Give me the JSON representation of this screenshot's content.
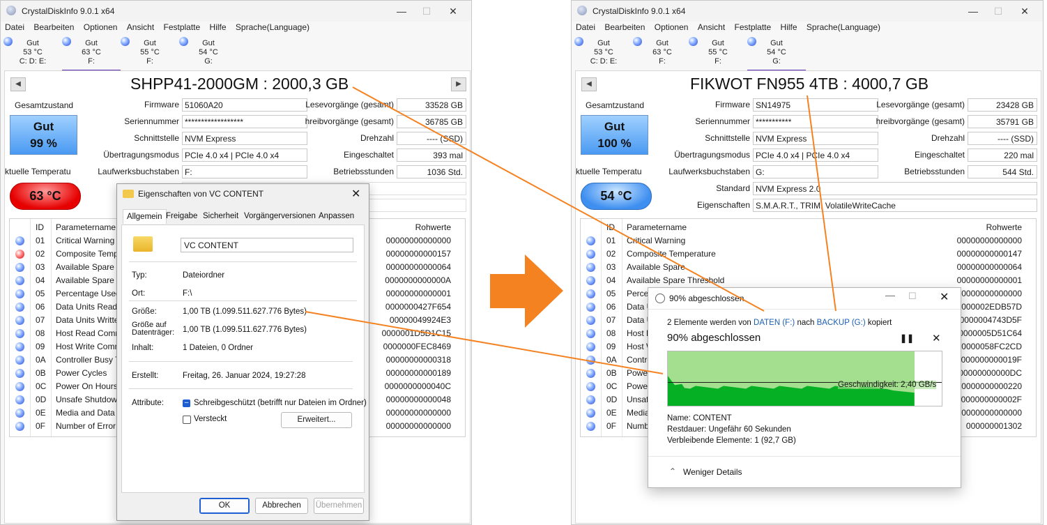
{
  "left_window": {
    "title": "CrystalDiskInfo 9.0.1 x64",
    "menu": [
      "Datei",
      "Bearbeiten",
      "Optionen",
      "Ansicht",
      "Festplatte",
      "Hilfe",
      "Sprache(Language)"
    ],
    "drives": [
      {
        "status": "Gut",
        "temp": "53 °C",
        "letters": "C: D: E:"
      },
      {
        "status": "Gut",
        "temp": "63 °C",
        "letters": "F:"
      },
      {
        "status": "Gut",
        "temp": "55 °C",
        "letters": "F:"
      },
      {
        "status": "Gut",
        "temp": "54 °C",
        "letters": "G:"
      }
    ],
    "model": "SHPP41-2000GM : 2000,3 GB",
    "health_label": "Gesamtzustand",
    "health_status": "Gut",
    "health_percent": "99 %",
    "temp_label": "ktuelle Temperatu",
    "temp_value": "63 °C",
    "labels": {
      "firmware": "Firmware",
      "serial": "Seriennummer",
      "interface": "Schnittstelle",
      "transfer": "Übertragungsmodus",
      "letters": "Laufwerksbuchstaben",
      "reads": "Lesevorgänge (gesamt)",
      "writes": "hreibvorgänge (gesamt)",
      "rpm": "Drehzahl",
      "poweron": "Eingeschaltet",
      "hours": "Betriebsstunden"
    },
    "values": {
      "firmware": "51060A20",
      "serial": "******************",
      "interface": "NVM Express",
      "transfer": "PCIe 4.0 x4 | PCIe 4.0 x4",
      "letters": "F:",
      "reads": "33528 GB",
      "writes": "36785 GB",
      "rpm": "---- (SSD)",
      "poweron": "393 mal",
      "hours": "1036 Std."
    },
    "smart_headers": {
      "id": "ID",
      "name": "Parametername",
      "raw": "Rohwerte"
    },
    "smart_rows": [
      {
        "id": "01",
        "name": "Critical Warning",
        "raw": "00000000000000",
        "state": "ok"
      },
      {
        "id": "02",
        "name": "Composite Tempe",
        "raw": "00000000000157",
        "state": "warn"
      },
      {
        "id": "03",
        "name": "Available Spare",
        "raw": "00000000000064",
        "state": "ok"
      },
      {
        "id": "04",
        "name": "Available Spare T",
        "raw": "0000000000000A",
        "state": "ok"
      },
      {
        "id": "05",
        "name": "Percentage Used",
        "raw": "00000000000001",
        "state": "ok"
      },
      {
        "id": "06",
        "name": "Data Units Read",
        "raw": "0000000427F654",
        "state": "ok"
      },
      {
        "id": "07",
        "name": "Data Units Writte",
        "raw": "00000049924E3",
        "state": "ok"
      },
      {
        "id": "08",
        "name": "Host Read Comm",
        "raw": "0000001D5D1C15",
        "state": "ok"
      },
      {
        "id": "09",
        "name": "Host Write Comm",
        "raw": "0000000FEC8469",
        "state": "ok"
      },
      {
        "id": "0A",
        "name": "Controller Busy T",
        "raw": "00000000000318",
        "state": "ok"
      },
      {
        "id": "0B",
        "name": "Power Cycles",
        "raw": "00000000000189",
        "state": "ok"
      },
      {
        "id": "0C",
        "name": "Power On Hours",
        "raw": "0000000000040C",
        "state": "ok"
      },
      {
        "id": "0D",
        "name": "Unsafe Shutdowr",
        "raw": "00000000000048",
        "state": "ok"
      },
      {
        "id": "0E",
        "name": "Media and Data I",
        "raw": "00000000000000",
        "state": "ok"
      },
      {
        "id": "0F",
        "name": "Number of Error I",
        "raw": "00000000000000",
        "state": "ok"
      }
    ]
  },
  "right_window": {
    "title": "CrystalDiskInfo 9.0.1 x64",
    "menu": [
      "Datei",
      "Bearbeiten",
      "Optionen",
      "Ansicht",
      "Festplatte",
      "Hilfe",
      "Sprache(Language)"
    ],
    "drives": [
      {
        "status": "Gut",
        "temp": "53 °C",
        "letters": "C: D: E:"
      },
      {
        "status": "Gut",
        "temp": "63 °C",
        "letters": "F:"
      },
      {
        "status": "Gut",
        "temp": "55 °C",
        "letters": "F:"
      },
      {
        "status": "Gut",
        "temp": "54 °C",
        "letters": "G:"
      }
    ],
    "model": "FIKWOT FN955 4TB : 4000,7 GB",
    "health_label": "Gesamtzustand",
    "health_status": "Gut",
    "health_percent": "100 %",
    "temp_label": "ktuelle Temperatu",
    "temp_value": "54 °C",
    "labels": {
      "firmware": "Firmware",
      "serial": "Seriennummer",
      "interface": "Schnittstelle",
      "transfer": "Übertragungsmodus",
      "letters": "Laufwerksbuchstaben",
      "standard": "Standard",
      "features": "Eigenschaften",
      "reads": "Lesevorgänge (gesamt)",
      "writes": "hreibvorgänge (gesamt)",
      "rpm": "Drehzahl",
      "poweron": "Eingeschaltet",
      "hours": "Betriebsstunden"
    },
    "values": {
      "firmware": "SN14975",
      "serial": "***********",
      "interface": "NVM Express",
      "transfer": "PCIe 4.0 x4 | PCIe 4.0 x4",
      "letters": "G:",
      "standard": "NVM Express 2.0",
      "features": "S.M.A.R.T., TRIM, VolatileWriteCache",
      "reads": "23428 GB",
      "writes": "35791 GB",
      "rpm": "---- (SSD)",
      "poweron": "220 mal",
      "hours": "544 Std."
    },
    "smart_headers": {
      "id": "ID",
      "name": "Parametername",
      "raw": "Rohwerte"
    },
    "smart_rows": [
      {
        "id": "01",
        "name": "Critical Warning",
        "raw": "00000000000000"
      },
      {
        "id": "02",
        "name": "Composite Temperature",
        "raw": "00000000000147"
      },
      {
        "id": "03",
        "name": "Available Spare",
        "raw": "00000000000064"
      },
      {
        "id": "04",
        "name": "Available Spare Threshold",
        "raw": "00000000000001"
      },
      {
        "id": "05",
        "name": "Percen",
        "raw": "00000000000000"
      },
      {
        "id": "06",
        "name": "Data U",
        "raw": "000000002EDB57D"
      },
      {
        "id": "07",
        "name": "Data U",
        "raw": "000000004743D5F"
      },
      {
        "id": "08",
        "name": "Host R",
        "raw": "00000005D51C64"
      },
      {
        "id": "09",
        "name": "Host W",
        "raw": "0000000058FC2CD"
      },
      {
        "id": "0A",
        "name": "Contro",
        "raw": "000000000019F"
      },
      {
        "id": "0B",
        "name": "Power",
        "raw": "00000000000DC"
      },
      {
        "id": "0C",
        "name": "Power",
        "raw": "000000000000220"
      },
      {
        "id": "0D",
        "name": "Unsafe",
        "raw": "000000000002F"
      },
      {
        "id": "0E",
        "name": "Media",
        "raw": "00000000000000"
      },
      {
        "id": "0F",
        "name": "Numbe",
        "raw": "000000001302"
      }
    ]
  },
  "properties_dialog": {
    "title": "Eigenschaften von VC CONTENT",
    "tabs": [
      "Allgemein",
      "Freigabe",
      "Sicherheit",
      "Vorgängerversionen",
      "Anpassen"
    ],
    "name": "VC CONTENT",
    "type_label": "Typ:",
    "type_value": "Dateiordner",
    "location_label": "Ort:",
    "location_value": "F:\\",
    "size_label": "Größe:",
    "size_value": "1,00 TB (1.099.511.627.776 Bytes)",
    "disk_size_label": "Größe auf Datenträger:",
    "disk_size_value": "1,00 TB (1.099.511.627.776 Bytes)",
    "contents_label": "Inhalt:",
    "contents_value": "1 Dateien, 0 Ordner",
    "created_label": "Erstellt:",
    "created_value": "Freitag, 26. Januar 2024, 19:27:28",
    "attributes_label": "Attribute:",
    "readonly_label": "Schreibgeschützt (betrifft nur Dateien im Ordner)",
    "hidden_label": "Versteckt",
    "advanced_button": "Erweitert...",
    "ok": "OK",
    "cancel": "Abbrechen",
    "apply": "Übernehmen"
  },
  "copy_dialog": {
    "title": "90% abgeschlossen",
    "line_prefix": "2 Elemente werden von",
    "source": "DATEN (F:)",
    "line_mid": "nach",
    "dest": "BACKUP (G:)",
    "line_suffix": "kopiert",
    "progress_text": "90% abgeschlossen",
    "progress": 0.9,
    "speed": "Geschwindigkeit: 2,40 GB/s",
    "name_label": "Name:",
    "name_value": "CONTENT",
    "remaining_label": "Restdauer:",
    "remaining_value": "Ungefähr 60 Sekunden",
    "items_label": "Verbleibende Elemente:",
    "items_value": "1 (92,7 GB)",
    "less_details": "Weniger Details"
  },
  "colors": {
    "accent_arrow": "#f58220",
    "health_blue": "#4a9af2",
    "temp_red": "#e60000",
    "progress_green": "#06b025"
  }
}
